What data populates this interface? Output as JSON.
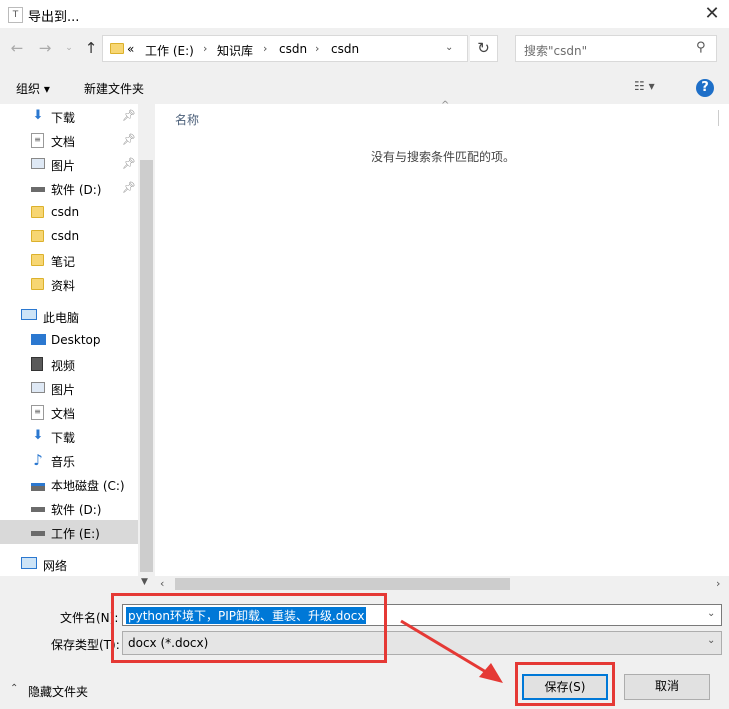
{
  "window": {
    "title": "导出到...",
    "app_icon": "T"
  },
  "address": {
    "prefix": "«",
    "breadcrumbs": [
      "工作 (E:)",
      "知识库",
      "csdn",
      "csdn"
    ],
    "separator": "›"
  },
  "search": {
    "placeholder": "搜索\"csdn\""
  },
  "toolbar": {
    "organize": "组织 ▾",
    "new_folder": "新建文件夹",
    "view": "☷ ▾",
    "help": "?"
  },
  "nav": {
    "quick_access": [
      {
        "label": "下载",
        "icon": "download-arrow-icon",
        "pinned": true
      },
      {
        "label": "文档",
        "icon": "document-icon",
        "pinned": true
      },
      {
        "label": "图片",
        "icon": "picture-icon",
        "pinned": true
      },
      {
        "label": "软件 (D:)",
        "icon": "drive-icon",
        "pinned": true
      },
      {
        "label": "csdn",
        "icon": "folder-icon",
        "pinned": false
      },
      {
        "label": "csdn",
        "icon": "folder-icon",
        "pinned": false
      },
      {
        "label": "笔记",
        "icon": "folder-icon",
        "pinned": false
      },
      {
        "label": "资料",
        "icon": "folder-icon",
        "pinned": false
      }
    ],
    "this_pc": {
      "label": "此电脑"
    },
    "pc_items": [
      {
        "label": "Desktop",
        "icon": "desktop-icon"
      },
      {
        "label": "视频",
        "icon": "video-icon"
      },
      {
        "label": "图片",
        "icon": "picture-icon"
      },
      {
        "label": "文档",
        "icon": "document-icon"
      },
      {
        "label": "下载",
        "icon": "download-arrow-icon"
      },
      {
        "label": "音乐",
        "icon": "music-icon"
      },
      {
        "label": "本地磁盘 (C:)",
        "icon": "system-drive-icon"
      },
      {
        "label": "软件 (D:)",
        "icon": "drive-icon"
      },
      {
        "label": "工作 (E:)",
        "icon": "drive-icon"
      }
    ],
    "network": {
      "label": "网络"
    }
  },
  "content": {
    "column_name": "名称",
    "empty_message": "没有与搜索条件匹配的项。"
  },
  "form": {
    "filename_label": "文件名(N):",
    "filename_value": "python环境下，PIP卸载、重装、升级.docx",
    "filetype_label": "保存类型(T):",
    "filetype_value": "docx (*.docx)"
  },
  "footer": {
    "hide_folders": "隐藏文件夹"
  },
  "buttons": {
    "save": "保存(S)",
    "cancel": "取消"
  },
  "colors": {
    "accent": "#0078d7",
    "annotation": "#e53935",
    "folder": "#f7d673"
  }
}
